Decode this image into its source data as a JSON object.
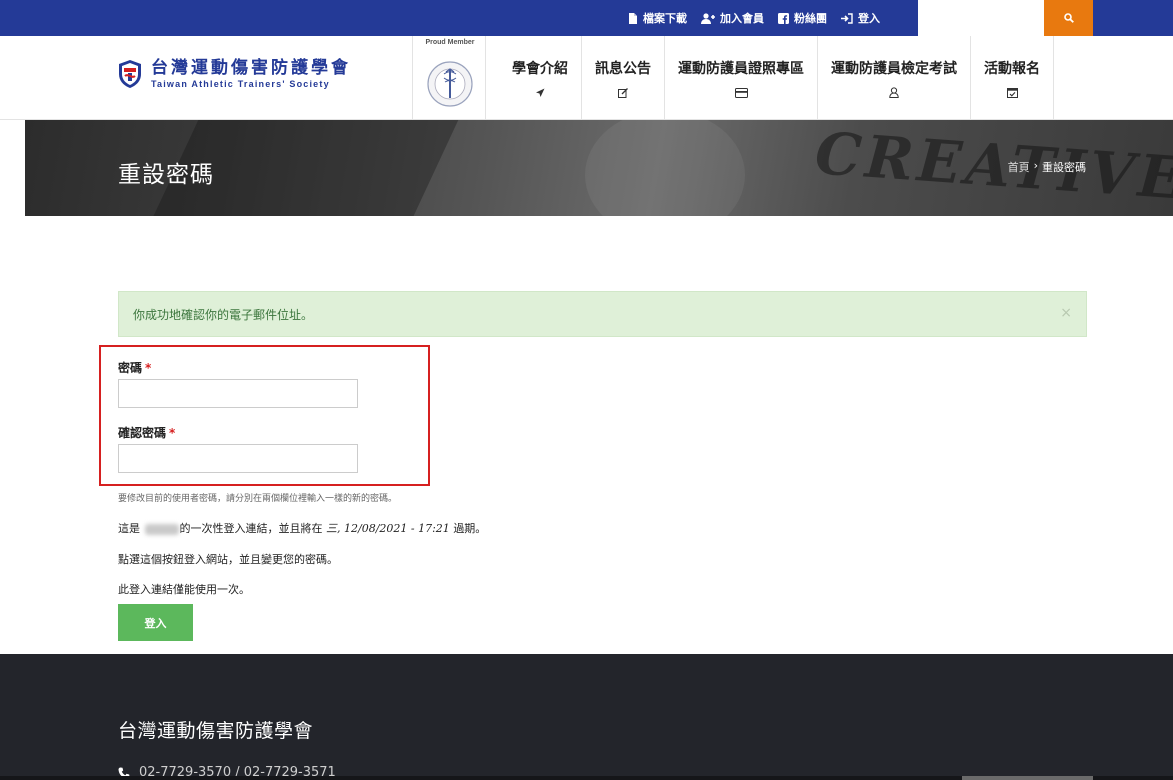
{
  "topbar": {
    "links": [
      {
        "label": "檔案下載",
        "icon": "document-icon"
      },
      {
        "label": "加入會員",
        "icon": "add-user-icon"
      },
      {
        "label": "粉絲團",
        "icon": "facebook-icon"
      },
      {
        "label": "登入",
        "icon": "sign-in-icon"
      }
    ],
    "search_icon": "search-icon",
    "bar_color": "#243a97",
    "search_color": "#e8790f"
  },
  "header": {
    "logo_cn": "台灣運動傷害防護學會",
    "logo_en": "Taiwan Athletic Trainers' Society",
    "member_label": "Proud Member"
  },
  "nav": [
    {
      "label": "學會介紹",
      "icon": "send-icon"
    },
    {
      "label": "訊息公告",
      "icon": "edit-icon"
    },
    {
      "label": "運動防護員證照專區",
      "icon": "credit-card-icon"
    },
    {
      "label": "運動防護員檢定考試",
      "icon": "user-icon"
    },
    {
      "label": "活動報名",
      "icon": "calendar-check-icon"
    }
  ],
  "banner": {
    "title": "重設密碼",
    "breadcrumb_home": "首頁",
    "breadcrumb_sep": "›",
    "breadcrumb_current": "重設密碼"
  },
  "alert": {
    "message": "你成功地確認你的電子郵件位址。",
    "close": "×",
    "color": "#dff0d8"
  },
  "form": {
    "password_label": "密碼",
    "confirm_label": "確認密碼",
    "required_mark": "*",
    "password_value": "",
    "confirm_value": "",
    "help": "要修改目前的使用者密碼，請分別在兩個欄位裡輸入一樣的新的密碼。"
  },
  "info": {
    "line1_prefix": "這是",
    "line1_mid": "的一次性登入連結，並且將在",
    "line1_date": "三, 12/08/2021 - 17:21",
    "line1_suffix": "過期。",
    "line2": "點選這個按鈕登入網站，並且變更您的密碼。",
    "line3": "此登入連結僅能使用一次。",
    "button": "登入",
    "button_color": "#5cb85c"
  },
  "footer": {
    "title": "台灣運動傷害防護學會",
    "phone": "02-7729-3570 / 02-7729-3571",
    "phone_icon": "phone-icon"
  }
}
